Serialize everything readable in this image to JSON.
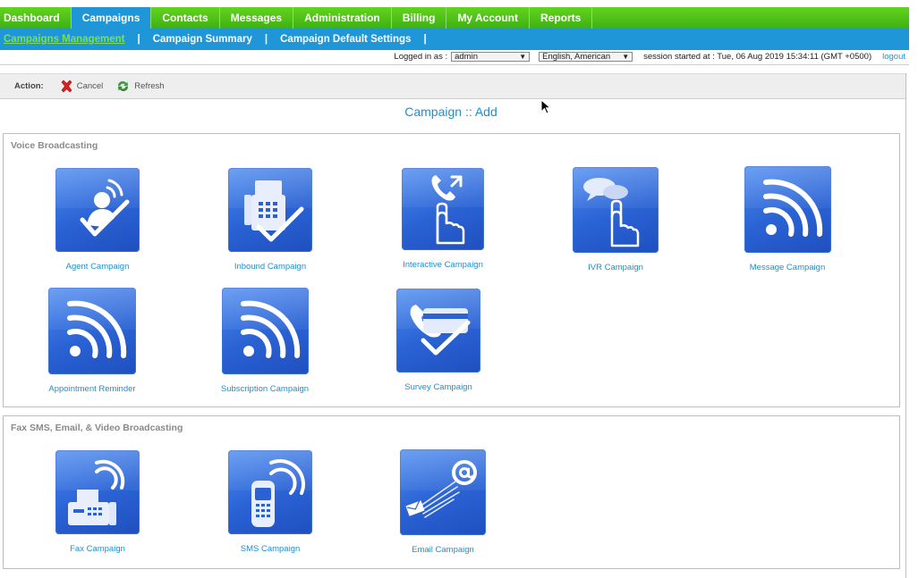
{
  "main_nav": {
    "tabs": [
      {
        "label": "Dashboard",
        "active": false
      },
      {
        "label": "Campaigns",
        "active": true
      },
      {
        "label": "Contacts",
        "active": false
      },
      {
        "label": "Messages",
        "active": false
      },
      {
        "label": "Administration",
        "active": false
      },
      {
        "label": "Billing",
        "active": false
      },
      {
        "label": "My Account",
        "active": false
      },
      {
        "label": "Reports",
        "active": false
      }
    ]
  },
  "sub_nav": {
    "links": [
      "Campaigns Management",
      "Campaign Summary",
      "Campaign Default Settings"
    ],
    "separator": "|"
  },
  "login_bar": {
    "logged_in_label": "Logged in as :",
    "user": "admin",
    "language": "English, American",
    "session_text": "session started at : Tue, 06 Aug 2019 15:34:11 (GMT +0500)",
    "logout": "logout"
  },
  "action_bar": {
    "label": "Action:",
    "cancel": "Cancel",
    "refresh": "Refresh"
  },
  "page_title": "Campaign :: Add",
  "sections": {
    "voice": {
      "title": "Voice Broadcasting",
      "cards": [
        "Agent Campaign",
        "Inbound Campaign",
        "Interactive Campaign",
        "IVR Campaign",
        "Message Campaign",
        "Appointment Reminder",
        "Subscription Campaign",
        "Survey Campaign"
      ]
    },
    "fax": {
      "title": "Fax SMS, Email, & Video Broadcasting",
      "cards": [
        "Fax Campaign",
        "SMS Campaign",
        "Email Campaign"
      ]
    }
  },
  "colors": {
    "nav_green": "#4fc418",
    "nav_blue": "#1e96d8",
    "tile_blue": "#2a62d4",
    "link_blue": "#1e8fd0"
  }
}
